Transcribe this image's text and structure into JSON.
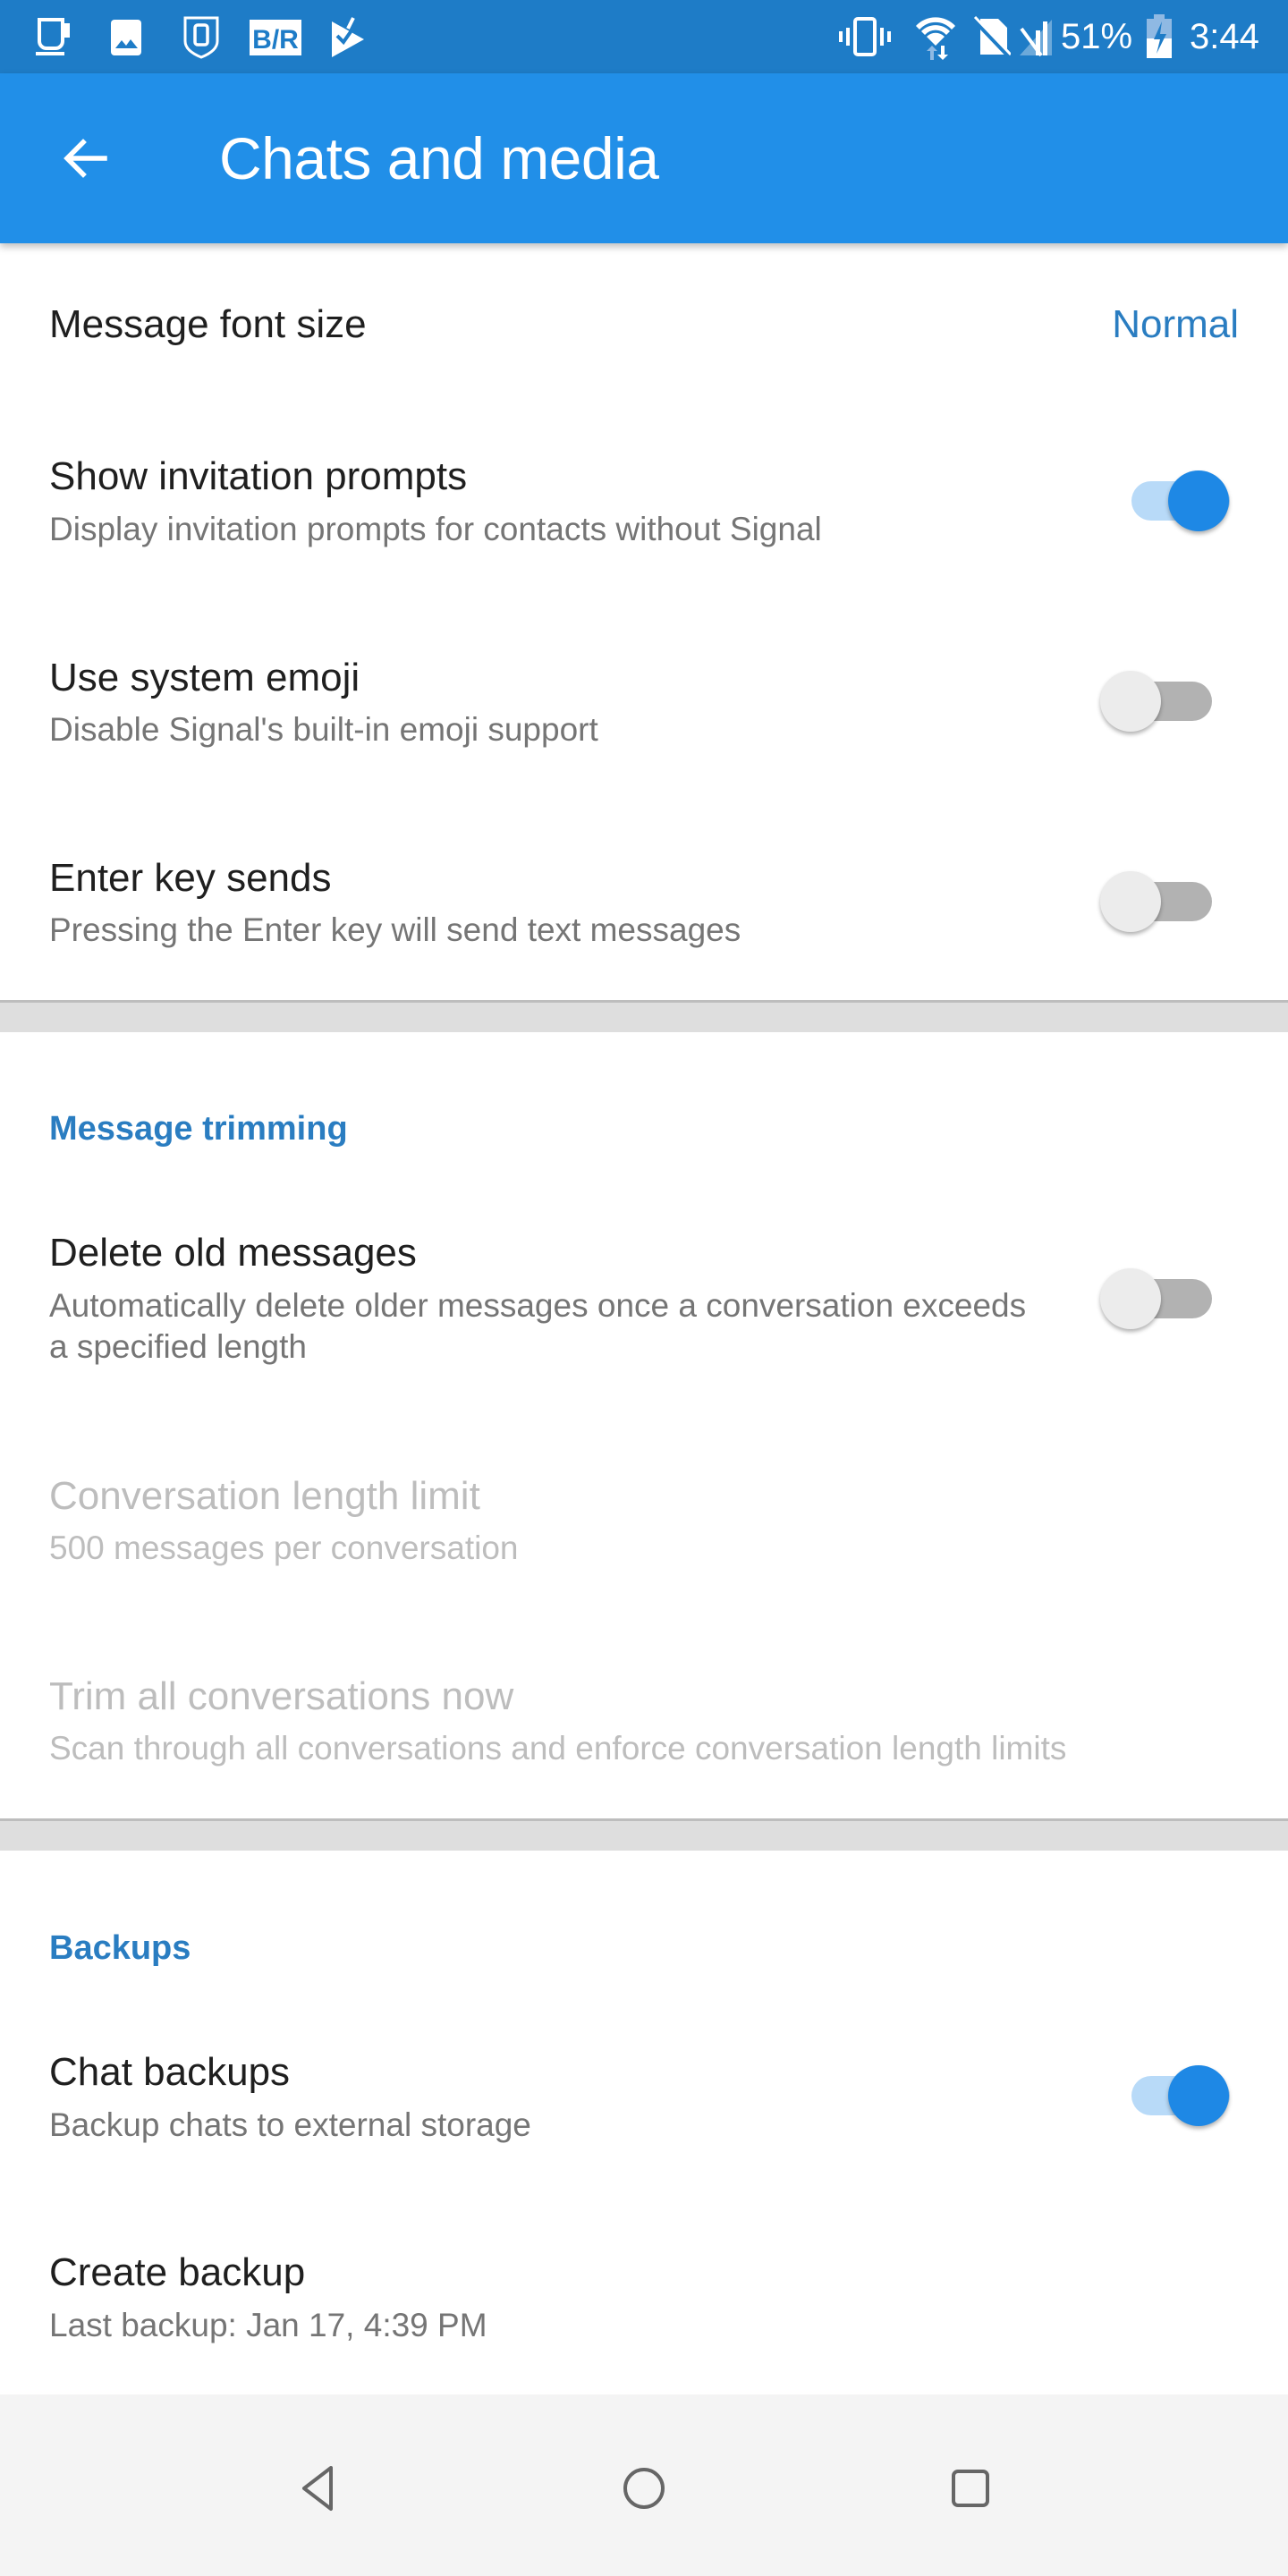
{
  "status_bar": {
    "left_icons": [
      "coffee-cup-icon",
      "gallery-image-icon",
      "shield-phone-icon",
      "br-app-icon",
      "check-ticket-icon"
    ],
    "right_icons": [
      "vibrate-icon",
      "wifi-data-icon",
      "no-sim-icon",
      "no-signal-icon"
    ],
    "battery_percent": "51%",
    "battery_level": 0.51,
    "battery_charging": true,
    "time": "3:44"
  },
  "app_bar": {
    "back_icon": "arrow-back-icon",
    "title": "Chats and media"
  },
  "colors": {
    "status_bar": "#1E7CC7",
    "app_bar": "#218FE8",
    "accent": "#1E88E5",
    "section_header": "#2A7DC1",
    "divider": "#DEDEDE",
    "nav_bar": "#F4F4F4"
  },
  "settings": {
    "font_size": {
      "title": "Message font size",
      "value": "Normal"
    },
    "invitation_prompts": {
      "title": "Show invitation prompts",
      "subtitle": "Display invitation prompts for contacts without Signal",
      "enabled": true
    },
    "system_emoji": {
      "title": "Use system emoji",
      "subtitle": "Disable Signal's built-in emoji support",
      "enabled": false
    },
    "enter_key_sends": {
      "title": "Enter key sends",
      "subtitle": "Pressing the Enter key will send text messages",
      "enabled": false
    }
  },
  "message_trimming": {
    "header": "Message trimming",
    "delete_old": {
      "title": "Delete old messages",
      "subtitle": "Automatically delete older messages once a conversation exceeds a specified length",
      "enabled": false
    },
    "length_limit": {
      "title": "Conversation length limit",
      "subtitle": "500 messages per conversation",
      "disabled": true
    },
    "trim_all": {
      "title": "Trim all conversations now",
      "subtitle": "Scan through all conversations and enforce conversation length limits",
      "disabled": true
    }
  },
  "backups": {
    "header": "Backups",
    "chat_backups": {
      "title": "Chat backups",
      "subtitle": "Backup chats to external storage",
      "enabled": true
    },
    "create_backup": {
      "title": "Create backup",
      "subtitle": "Last backup: Jan 17, 4:39 PM"
    }
  },
  "nav_bar": {
    "back": "nav-back-icon",
    "home": "nav-home-icon",
    "recents": "nav-recents-icon"
  }
}
